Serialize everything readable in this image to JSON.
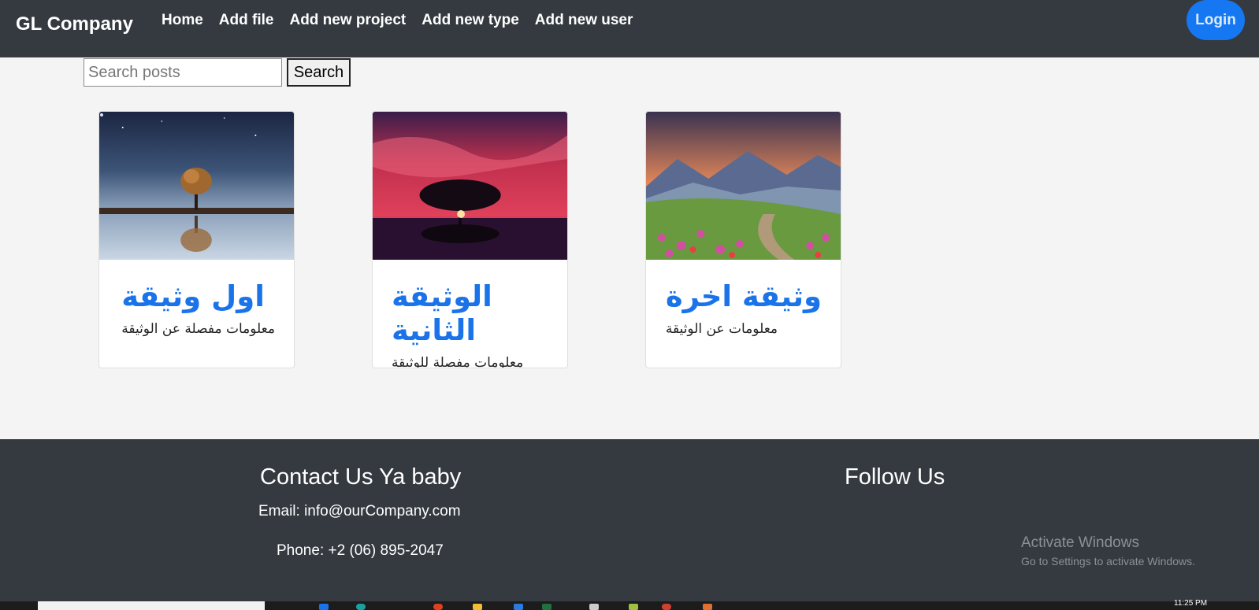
{
  "navbar": {
    "brand": "GL Company",
    "links": [
      "Home",
      "Add file",
      "Add new project",
      "Add new type",
      "Add new user"
    ],
    "login_label": "Login"
  },
  "search": {
    "placeholder": "Search posts",
    "value": "",
    "button_label": "Search"
  },
  "cards": [
    {
      "title": "اول وثيقة",
      "text": "معلومات مفصلة عن الوثيقة"
    },
    {
      "title": "الوثيقة الثانية",
      "text": "معلومات مفصلة للوثيقة الثانية"
    },
    {
      "title": "وثيقة اخرة",
      "text": "معلومات عن الوثيقة"
    }
  ],
  "footer": {
    "contact_title": "Contact Us Ya baby",
    "email": "Email: info@ourCompany.com",
    "phone": "Phone: +2 (06) 895-2047",
    "follow_title": "Follow Us"
  },
  "watermark": {
    "title": "Activate Windows",
    "subtitle": "Go to Settings to activate Windows."
  },
  "taskbar": {
    "clock": "11:25 PM"
  },
  "colors": {
    "navbar_bg": "#343a40",
    "accent": "#1677f2",
    "card_title": "#1a73e8",
    "page_bg": "#f4f4f4"
  }
}
